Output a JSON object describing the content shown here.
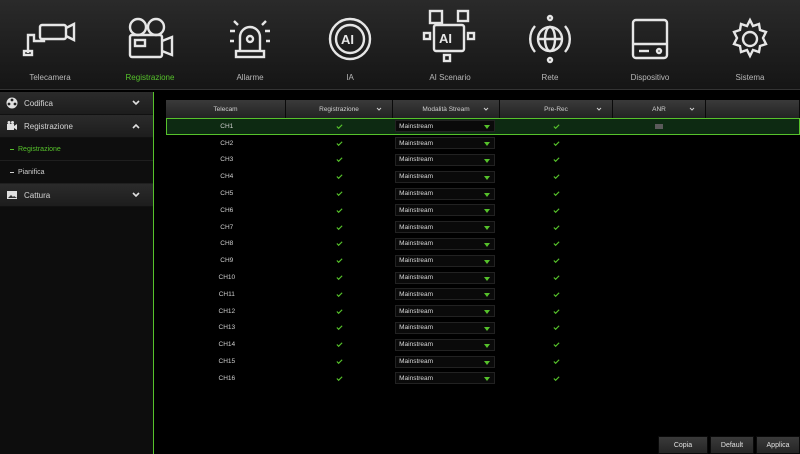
{
  "nav": [
    {
      "label": "Telecamera",
      "icon": "camera-icon",
      "active": false
    },
    {
      "label": "Registrazione",
      "icon": "video-camera-icon",
      "active": true
    },
    {
      "label": "Allarme",
      "icon": "alarm-siren-icon",
      "active": false
    },
    {
      "label": "IA",
      "icon": "ai-chip-icon",
      "active": false
    },
    {
      "label": "AI Scenario",
      "icon": "ai-scenario-icon",
      "active": false
    },
    {
      "label": "Rete",
      "icon": "network-globe-icon",
      "active": false
    },
    {
      "label": "Dispositivo",
      "icon": "hard-disk-icon",
      "active": false
    },
    {
      "label": "Sistema",
      "icon": "gear-icon",
      "active": false
    }
  ],
  "sidebar": {
    "codifica": "Codifica",
    "registrazione": "Registrazione",
    "sub": [
      "Registrazione",
      "Pianifica"
    ],
    "cattura": "Cattura"
  },
  "table": {
    "headers": [
      "Telecam",
      "Registrazione",
      "Modalità Stream",
      "Pre-Rec",
      "ANR"
    ],
    "rows": [
      {
        "ch": "CH1",
        "stream": "Mainstream"
      },
      {
        "ch": "CH2",
        "stream": "Mainstream"
      },
      {
        "ch": "CH3",
        "stream": "Mainstream"
      },
      {
        "ch": "CH4",
        "stream": "Mainstream"
      },
      {
        "ch": "CH5",
        "stream": "Mainstream"
      },
      {
        "ch": "CH6",
        "stream": "Mainstream"
      },
      {
        "ch": "CH7",
        "stream": "Mainstream"
      },
      {
        "ch": "CH8",
        "stream": "Mainstream"
      },
      {
        "ch": "CH9",
        "stream": "Mainstream"
      },
      {
        "ch": "CH10",
        "stream": "Mainstream"
      },
      {
        "ch": "CH11",
        "stream": "Mainstream"
      },
      {
        "ch": "CH12",
        "stream": "Mainstream"
      },
      {
        "ch": "CH13",
        "stream": "Mainstream"
      },
      {
        "ch": "CH14",
        "stream": "Mainstream"
      },
      {
        "ch": "CH15",
        "stream": "Mainstream"
      },
      {
        "ch": "CH16",
        "stream": "Mainstream"
      }
    ]
  },
  "buttons": {
    "copy": "Copia",
    "default": "Default",
    "apply": "Applica"
  },
  "colors": {
    "accent": "#56c22b"
  }
}
